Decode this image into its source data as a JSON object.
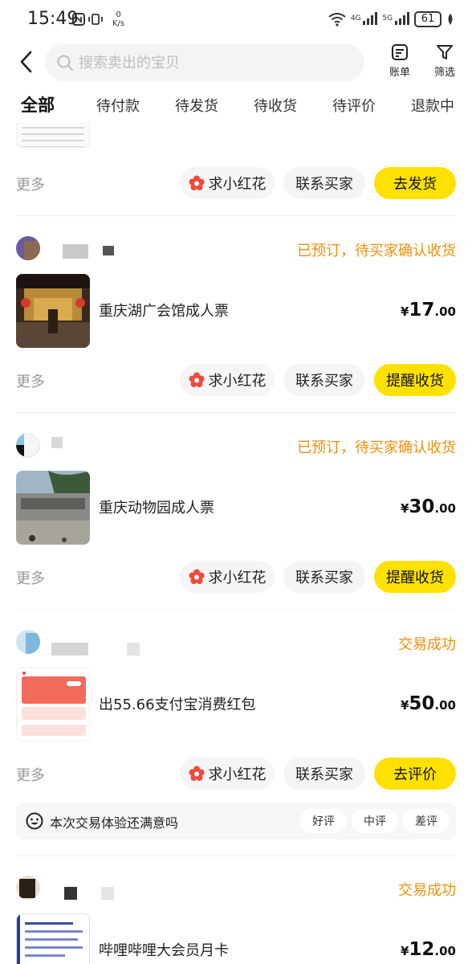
{
  "status_bar": {
    "time": "15:49",
    "net_speed_value": "0",
    "net_speed_unit": "K/s",
    "signal_1": "4G",
    "signal_2": "5G",
    "battery": "61"
  },
  "header": {
    "search_placeholder": "搜索卖出的宝贝",
    "bill_label": "账单",
    "filter_label": "筛选"
  },
  "tabs": [
    {
      "label": "全部",
      "active": true
    },
    {
      "label": "待付款"
    },
    {
      "label": "待发货"
    },
    {
      "label": "待收货"
    },
    {
      "label": "待评价"
    },
    {
      "label": "退款中"
    }
  ],
  "actions": {
    "more": "更多",
    "flower": "求小红花",
    "contact": "联系买家"
  },
  "orders": [
    {
      "primary_action": "去发货"
    },
    {
      "status": "已预订，待买家确认收货",
      "title": "重庆湖广会馆成人票",
      "price_currency": "¥",
      "price_int": "17",
      "price_dec": ".00",
      "primary_action": "提醒收货"
    },
    {
      "status": "已预订，待买家确认收货",
      "title": "重庆动物园成人票",
      "price_currency": "¥",
      "price_int": "30",
      "price_dec": ".00",
      "primary_action": "提醒收货"
    },
    {
      "status": "交易成功",
      "title": "出55.66支付宝消费红包",
      "price_currency": "¥",
      "price_int": "50",
      "price_dec": ".00",
      "primary_action": "去评价",
      "feedback": {
        "question": "本次交易体验还满意吗",
        "good": "好评",
        "neutral": "中评",
        "bad": "差评"
      }
    },
    {
      "status": "交易成功",
      "title": "哔哩哔哩大会员月卡",
      "price_currency": "¥",
      "price_int": "12",
      "price_dec": ".00"
    }
  ],
  "colors": {
    "accent_yellow": "#ffe100",
    "status_orange": "#f0900a",
    "flower_red": "#f04a3a"
  }
}
